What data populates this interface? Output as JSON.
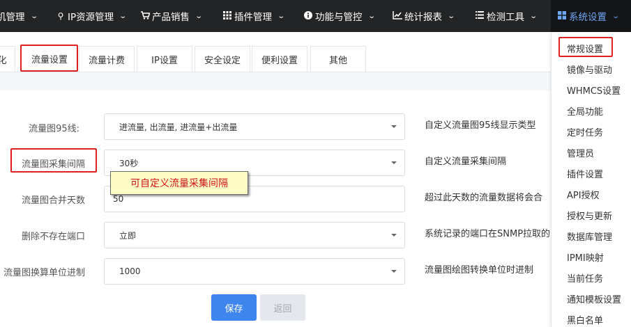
{
  "topnav": {
    "items": [
      {
        "label": "机管理",
        "icon": ""
      },
      {
        "label": "IP资源管理",
        "icon": "map-marker-icon"
      },
      {
        "label": "产品销售",
        "icon": "cart-icon"
      },
      {
        "label": "插件管理",
        "icon": "grid-icon"
      },
      {
        "label": "功能与管控",
        "icon": "info-circle-icon"
      },
      {
        "label": "统计报表",
        "icon": "chart-line-icon"
      },
      {
        "label": "检测工具",
        "icon": "list-icon"
      },
      {
        "label": "系统设置",
        "icon": "windows-icon"
      }
    ],
    "active_color": "#6fa6f5",
    "background": "#222426"
  },
  "tabs": [
    {
      "label": "优化"
    },
    {
      "label": "流量设置"
    },
    {
      "label": "流量计费"
    },
    {
      "label": "IP设置"
    },
    {
      "label": "安全设定"
    },
    {
      "label": "便利设置"
    },
    {
      "label": "其他"
    }
  ],
  "form": {
    "rows": [
      {
        "label": "流量图95线:",
        "value": "进流量, 出流量, 进流量+出流量",
        "help": "自定义流量图95线显示类型"
      },
      {
        "label": "流量图采集间隔",
        "value": "30秒",
        "help": "自定义流量采集间隔"
      },
      {
        "label": "流量图合并天数",
        "value": "50",
        "help": "超过此天数的流量数据将会合"
      },
      {
        "label": "删除不存在端口",
        "value": "立即",
        "help": "系统记录的端口在SNMP拉取的"
      },
      {
        "label": "流量图换算单位进制",
        "value": "1000",
        "help": "流量图绘图转换单位时进制"
      }
    ],
    "save_label": "保存",
    "back_label": "返回"
  },
  "tooltip": {
    "text": "可自定义流量采集间隔"
  },
  "dropdown": {
    "items": [
      "常规设置",
      "镜像与驱动",
      "WHMCS设置",
      "全局功能",
      "定时任务",
      "管理员",
      "插件设置",
      "API授权",
      "授权与更新",
      "数据库管理",
      "IPMI映射",
      "当前任务",
      "通知模板设置",
      "黑白名单"
    ]
  },
  "colors": {
    "highlight": "#e02020",
    "primary_button": "#3f85ee",
    "tooltip_bg": "#fdfbc6",
    "tooltip_text": "#d0121b"
  }
}
